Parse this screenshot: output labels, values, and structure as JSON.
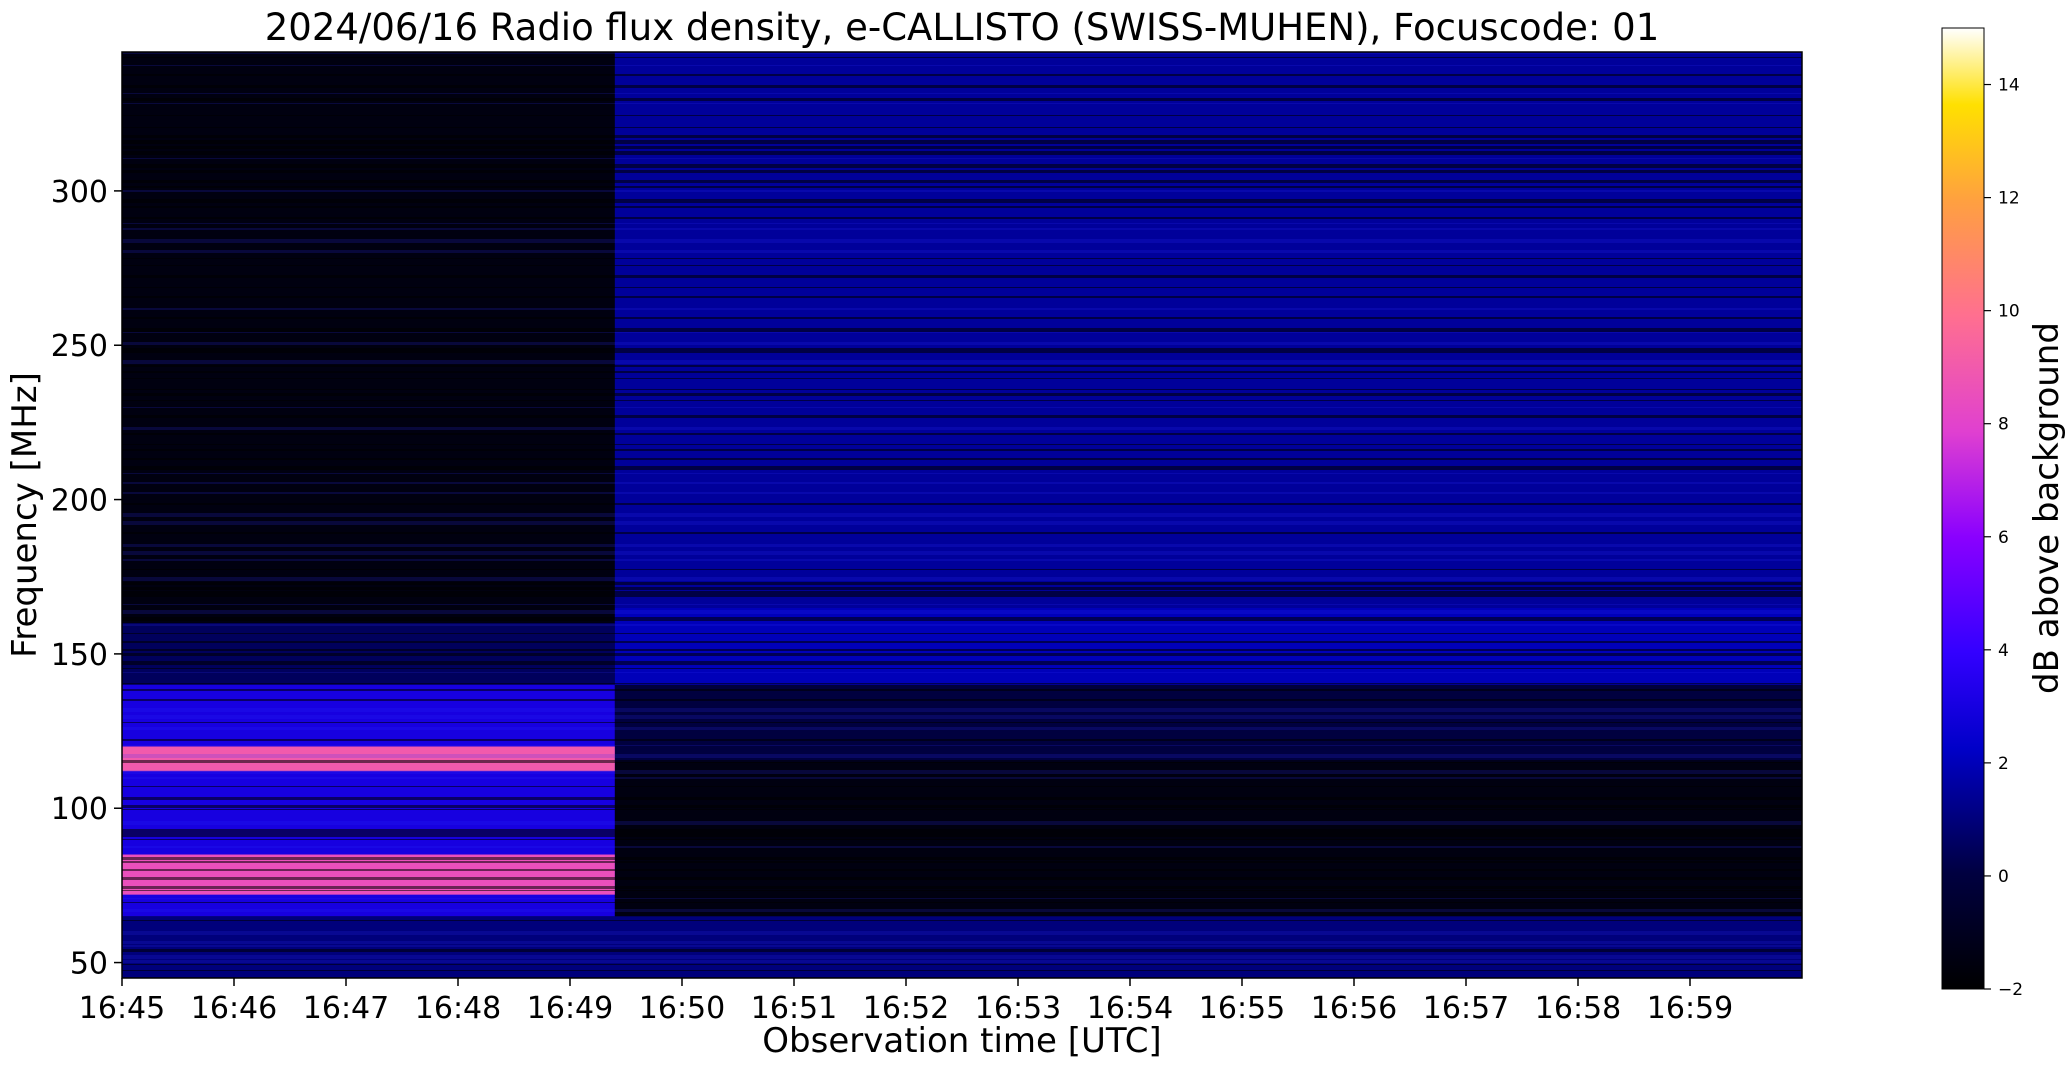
{
  "chart_data": {
    "type": "heatmap",
    "title": "2024/06/16  Radio flux density, e-CALLISTO (SWISS-MUHEN), Focuscode: 01",
    "xlabel": "Observation time [UTC]",
    "ylabel": "Frequency [MHz]",
    "colorbar_label": "dB above background",
    "colormap": "gnuplot2",
    "x_ticks": [
      "16:45",
      "16:46",
      "16:47",
      "16:48",
      "16:49",
      "16:50",
      "16:51",
      "16:52",
      "16:53",
      "16:54",
      "16:55",
      "16:56",
      "16:57",
      "16:58",
      "16:59"
    ],
    "xlim": [
      "16:45",
      "16:60"
    ],
    "y_ticks": [
      50,
      100,
      150,
      200,
      250,
      300
    ],
    "ylim": [
      45,
      345
    ],
    "colorbar_ticks": [
      -2,
      0,
      2,
      4,
      6,
      8,
      10,
      12,
      14
    ],
    "color_range": [
      -2,
      15
    ],
    "regions": [
      {
        "t_start": "16:45",
        "t_end": "16:49.4",
        "freq_min": 160,
        "freq_max": 345,
        "level_db": -1.5
      },
      {
        "t_start": "16:45",
        "t_end": "16:49.4",
        "freq_min": 140,
        "freq_max": 160,
        "level_db": 0.5
      },
      {
        "t_start": "16:45",
        "t_end": "16:49.4",
        "freq_min": 112,
        "freq_max": 120,
        "level_db": 9
      },
      {
        "t_start": "16:45",
        "t_end": "16:49.4",
        "freq_min": 72,
        "freq_max": 85,
        "level_db": 8.5
      },
      {
        "t_start": "16:45",
        "t_end": "16:49.4",
        "freq_min": 65,
        "freq_max": 140,
        "level_db": 3
      },
      {
        "t_start": "16:49.4",
        "t_end": "16:60",
        "freq_min": 165,
        "freq_max": 345,
        "level_db": 1.5
      },
      {
        "t_start": "16:49.4",
        "t_end": "16:60",
        "freq_min": 140,
        "freq_max": 165,
        "level_db": 2
      },
      {
        "t_start": "16:49.4",
        "t_end": "16:60",
        "freq_min": 115,
        "freq_max": 140,
        "level_db": 0
      },
      {
        "t_start": "16:49.4",
        "t_end": "16:60",
        "freq_min": 65,
        "freq_max": 115,
        "level_db": -1.5
      },
      {
        "t_start": "16:45",
        "t_end": "16:60",
        "freq_min": 45,
        "freq_max": 65,
        "level_db": 1
      }
    ]
  }
}
